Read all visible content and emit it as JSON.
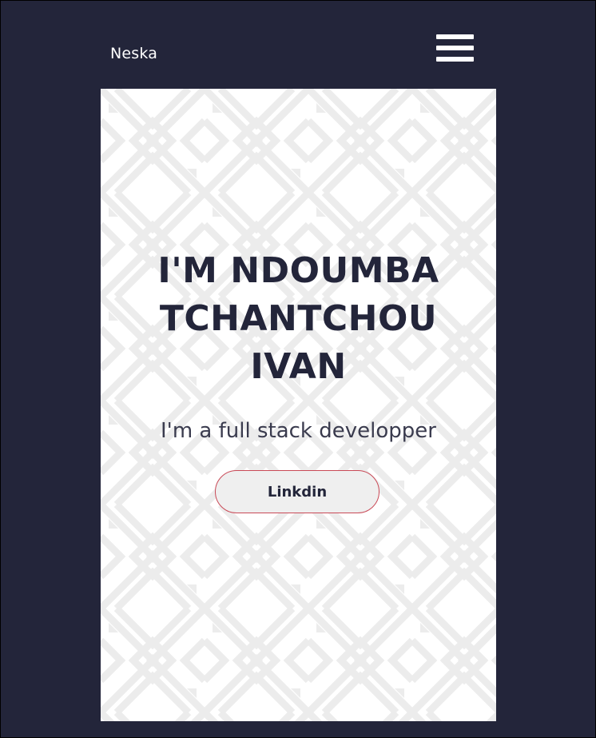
{
  "navbar": {
    "brand": "Neska",
    "menu_icon": "hamburger-menu-icon"
  },
  "hero": {
    "headline_lines": [
      "I'M NDOUMBA",
      "TCHANTCHOU",
      "IVAN"
    ],
    "subtitle": "I'm a full stack developper",
    "cta_label": "Linkdin",
    "background_pattern": "geometric-tribal-pattern"
  },
  "colors": {
    "page_background": "#23253a",
    "hero_background": "#ffffff",
    "pattern_color": "#ececec",
    "headline_color": "#23253a",
    "button_border": "#c94a57",
    "button_fill": "#efefef"
  }
}
